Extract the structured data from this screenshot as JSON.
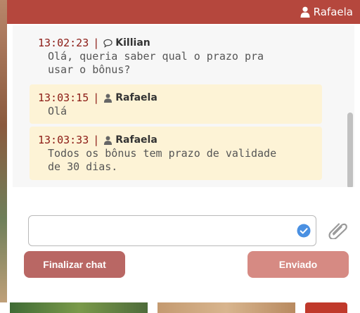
{
  "header": {
    "user_name": "Rafaela"
  },
  "messages": [
    {
      "time": "13:02:23",
      "separator": "|",
      "author": "Killian",
      "author_icon": "chat-bubble-icon",
      "text": "Olá, queria saber qual o prazo pra\nusar o bônus?"
    },
    {
      "time": "13:03:15",
      "separator": "|",
      "author": "Rafaela",
      "author_icon": "user-icon",
      "text": "Olá"
    },
    {
      "time": "13:03:33",
      "separator": "|",
      "author": "Rafaela",
      "author_icon": "user-icon",
      "text": "Todos os bônus tem prazo de validade\nde 30 dias."
    }
  ],
  "composer": {
    "value": "",
    "placeholder": ""
  },
  "buttons": {
    "finish_label": "Finalizar chat",
    "send_label": "Enviado"
  },
  "colors": {
    "header_bg": "#b5473d",
    "agent_bubble": "#fdf3d6",
    "time_color": "#8b1a14",
    "finish_button": "#b96764",
    "send_button": "#d68a83",
    "check_icon": "#4a90e2"
  }
}
